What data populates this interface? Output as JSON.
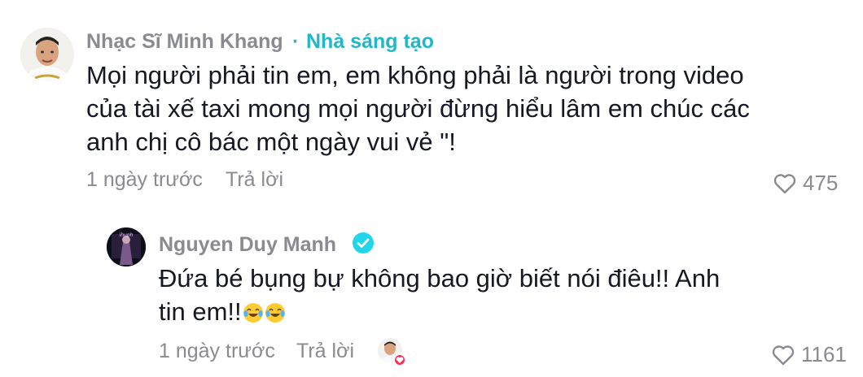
{
  "comments": [
    {
      "username": "Nhạc Sĩ Minh Khang",
      "separator": "·",
      "badge": "Nhà sáng tạo",
      "text": "Mọi người phải tin em, em không phải là người trong video của tài xế taxi mong mọi người đừng hiểu lâm em chúc các anh chị cô bác một ngày vui vẻ \"!",
      "time": "1 ngày trước",
      "reply_label": "Trả lời",
      "likes": "475"
    },
    {
      "username": "Nguyen Duy Manh",
      "verified": true,
      "text": "Đứa bé bụng bự không bao giờ biết nói điêu!! Anh tin em!!",
      "emojis": [
        "face-with-tears-of-joy",
        "face-with-tears-of-joy"
      ],
      "time": "1 ngày trước",
      "reply_label": "Trả lời",
      "creator_liked": true,
      "likes": "1161"
    }
  ],
  "colors": {
    "creator_badge": "#20b7c8",
    "verified": "#20d5ec",
    "muted": "#8a8b91",
    "text": "#161823",
    "like_heart": "#fe2c55"
  }
}
